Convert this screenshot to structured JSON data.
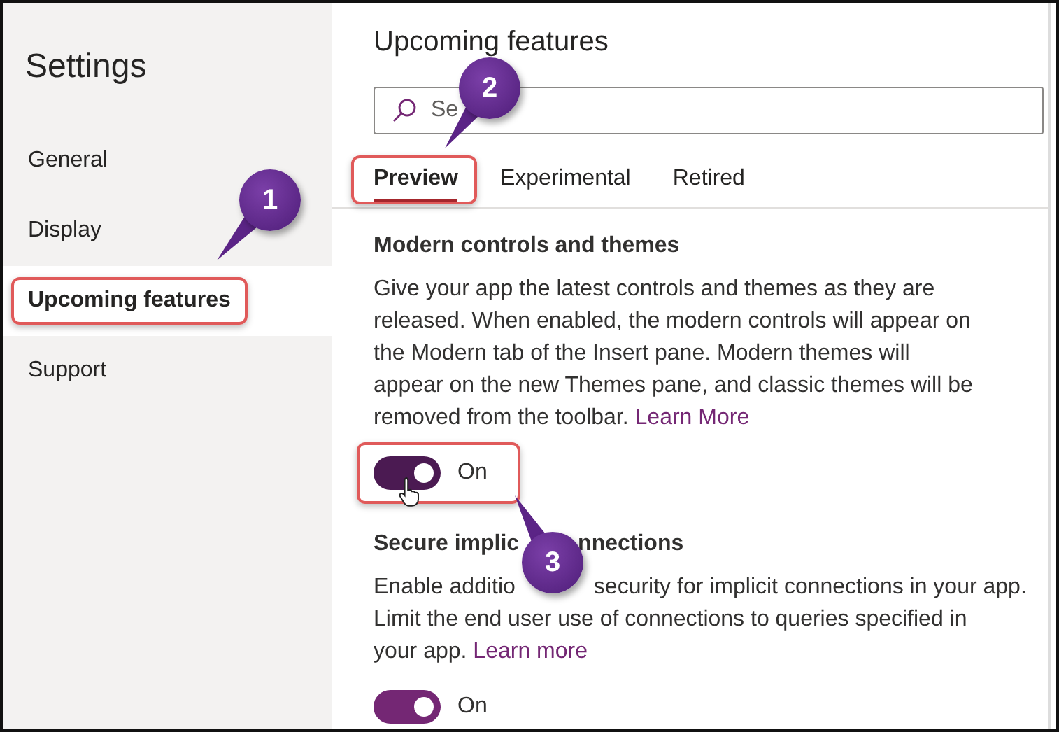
{
  "sidebar": {
    "title": "Settings",
    "items": [
      {
        "label": "General",
        "selected": false,
        "highlighted": false
      },
      {
        "label": "Display",
        "selected": false,
        "highlighted": false
      },
      {
        "label": "Upcoming features",
        "selected": true,
        "highlighted": true
      },
      {
        "label": "Support",
        "selected": false,
        "highlighted": false
      }
    ]
  },
  "main": {
    "title": "Upcoming features",
    "search": {
      "placeholder": "Se"
    },
    "tabs": [
      {
        "label": "Preview",
        "selected": true,
        "highlighted": true
      },
      {
        "label": "Experimental",
        "selected": false,
        "highlighted": false
      },
      {
        "label": "Retired",
        "selected": false,
        "highlighted": false
      }
    ],
    "features": [
      {
        "title": [
          "Modern controls and themes"
        ],
        "description": [
          [
            "Give your app the latest controls and themes as they are"
          ],
          [
            "released. When enabled, the modern controls will appear on"
          ],
          [
            "the Modern tab of the Insert pane. Modern themes will"
          ],
          [
            "appear on the new Themes pane, and classic themes will be"
          ],
          [
            "removed from the toolbar."
          ]
        ],
        "link": "Learn More",
        "toggle": {
          "on": true,
          "label": "On",
          "pressed": true,
          "highlighted": true
        }
      },
      {
        "title": [
          "Secure implic",
          "nnections"
        ],
        "description": [
          [
            "Enable additio",
            "security for implicit connections in your app."
          ],
          [
            "Limit the end user use of connections to queries specified in"
          ],
          [
            "your app."
          ]
        ],
        "link": "Learn more",
        "toggle": {
          "on": true,
          "label": "On",
          "pressed": false,
          "highlighted": false
        }
      }
    ]
  },
  "annotations": [
    {
      "number": "1"
    },
    {
      "number": "2"
    },
    {
      "number": "3"
    }
  ]
}
